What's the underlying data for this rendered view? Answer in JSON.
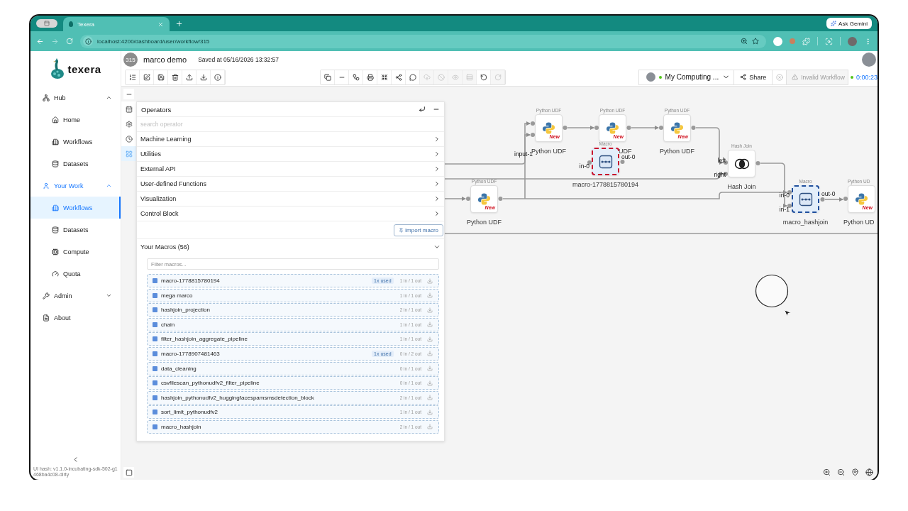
{
  "browser": {
    "tab_title": "Texera",
    "url": "localhost:4200/dashboard/user/workflow/315",
    "gemini_button": "Ask Gemini"
  },
  "sidebar": {
    "logo": "texera",
    "nav": [
      {
        "kind": "group",
        "label": "Hub",
        "expanded": true,
        "children": [
          {
            "label": "Home",
            "selected": false
          },
          {
            "label": "Workflows",
            "selected": false
          },
          {
            "label": "Datasets",
            "selected": false
          }
        ]
      },
      {
        "kind": "group",
        "label": "Your Work",
        "expanded": true,
        "children": [
          {
            "label": "Workflows",
            "selected": true
          },
          {
            "label": "Datasets",
            "selected": false
          },
          {
            "label": "Compute",
            "selected": false
          },
          {
            "label": "Quota",
            "selected": false
          }
        ]
      },
      {
        "kind": "group",
        "label": "Admin",
        "expanded": false
      },
      {
        "kind": "link",
        "label": "About"
      }
    ],
    "version": "UI hash: v1.1.0-incubating-sdk-502-g1468ba4c08-dirty"
  },
  "workflow": {
    "id_badge": "315",
    "name": "marco demo",
    "saved": "Saved at 05/16/2026 13:32:57"
  },
  "toolbar": {
    "middle_tools": [
      {
        "disabled": false
      },
      {
        "disabled": false
      },
      {
        "disabled": false
      },
      {
        "disabled": false
      },
      {
        "disabled": false
      },
      {
        "disabled": false
      },
      {
        "disabled": false
      },
      {
        "disabled": true
      },
      {
        "disabled": true
      },
      {
        "disabled": true
      },
      {
        "disabled": true
      },
      {
        "disabled": false
      },
      {
        "disabled": true
      }
    ],
    "computing_unit": "My Computing ...",
    "share": "Share",
    "status": "Invalid Workflow",
    "elapsed": "0:00:23"
  },
  "operators": {
    "title": "Operators",
    "search_placeholder": "search operator",
    "categories": [
      "Machine Learning",
      "Utilities",
      "External API",
      "User-defined Functions",
      "Visualization",
      "Control Block"
    ],
    "import_button": "Import macro",
    "macros_heading": "Your Macros (56)",
    "filter_placeholder": "Filter macros...",
    "macros": [
      {
        "name": "macro-1778815780194",
        "usage": "1x used",
        "ports": "1 in / 1 out"
      },
      {
        "name": "mega marco",
        "ports": "1 in / 1 out"
      },
      {
        "name": "hashjoin_projection",
        "ports": "2 in / 1 out"
      },
      {
        "name": "chain",
        "ports": "1 in / 1 out"
      },
      {
        "name": "filter_hashjoin_aggregate_pipeline",
        "ports": "1 in / 1 out"
      },
      {
        "name": "macro-1778907481463",
        "usage": "1x used",
        "ports": "0 in / 2 out"
      },
      {
        "name": "data_cleaning",
        "ports": "0 in / 1 out"
      },
      {
        "name": "csvfilescan_pythonudfv2_filter_pipeline",
        "ports": "0 in / 1 out"
      },
      {
        "name": "hashjoin_pythonudfv2_huggingfacespamsmsdetection_block",
        "ports": "2 in / 1 out"
      },
      {
        "name": "sort_limit_pythonudfv2",
        "ports": "1 in / 1 out"
      },
      {
        "name": "macro_hashjoin",
        "ports": "2 in / 1 out"
      }
    ]
  },
  "canvas": {
    "nodes": [
      {
        "kind": "python",
        "title": "Python UDF",
        "label": "Python UDF",
        "badge": "New",
        "inputs": [
          "input-1"
        ]
      },
      {
        "kind": "python",
        "title": "Python UDF",
        "label": "UDF",
        "badge": "New"
      },
      {
        "kind": "python",
        "title": "Python UDF",
        "label": "Python UDF",
        "badge": "New"
      },
      {
        "kind": "macro",
        "title": "Macro",
        "label": "macro-1778815780194",
        "color": "#c8102e",
        "inputs": [
          "in-0"
        ],
        "outputs": [
          "out-0"
        ]
      },
      {
        "kind": "join",
        "title": "Hash Join",
        "label": "Hash Join",
        "inputs": [
          "left",
          "right"
        ]
      },
      {
        "kind": "python",
        "title": "Python UDF",
        "label": "Python UDF",
        "badge": "New"
      },
      {
        "kind": "macro",
        "title": "Macro",
        "label": "macro_hashjoin",
        "color": "#1f4e9c",
        "inputs": [
          "in-0",
          "in-1"
        ],
        "outputs": [
          "out-0"
        ]
      },
      {
        "kind": "python",
        "title": "Python UD",
        "label": "Python UD",
        "badge": "New"
      }
    ]
  }
}
